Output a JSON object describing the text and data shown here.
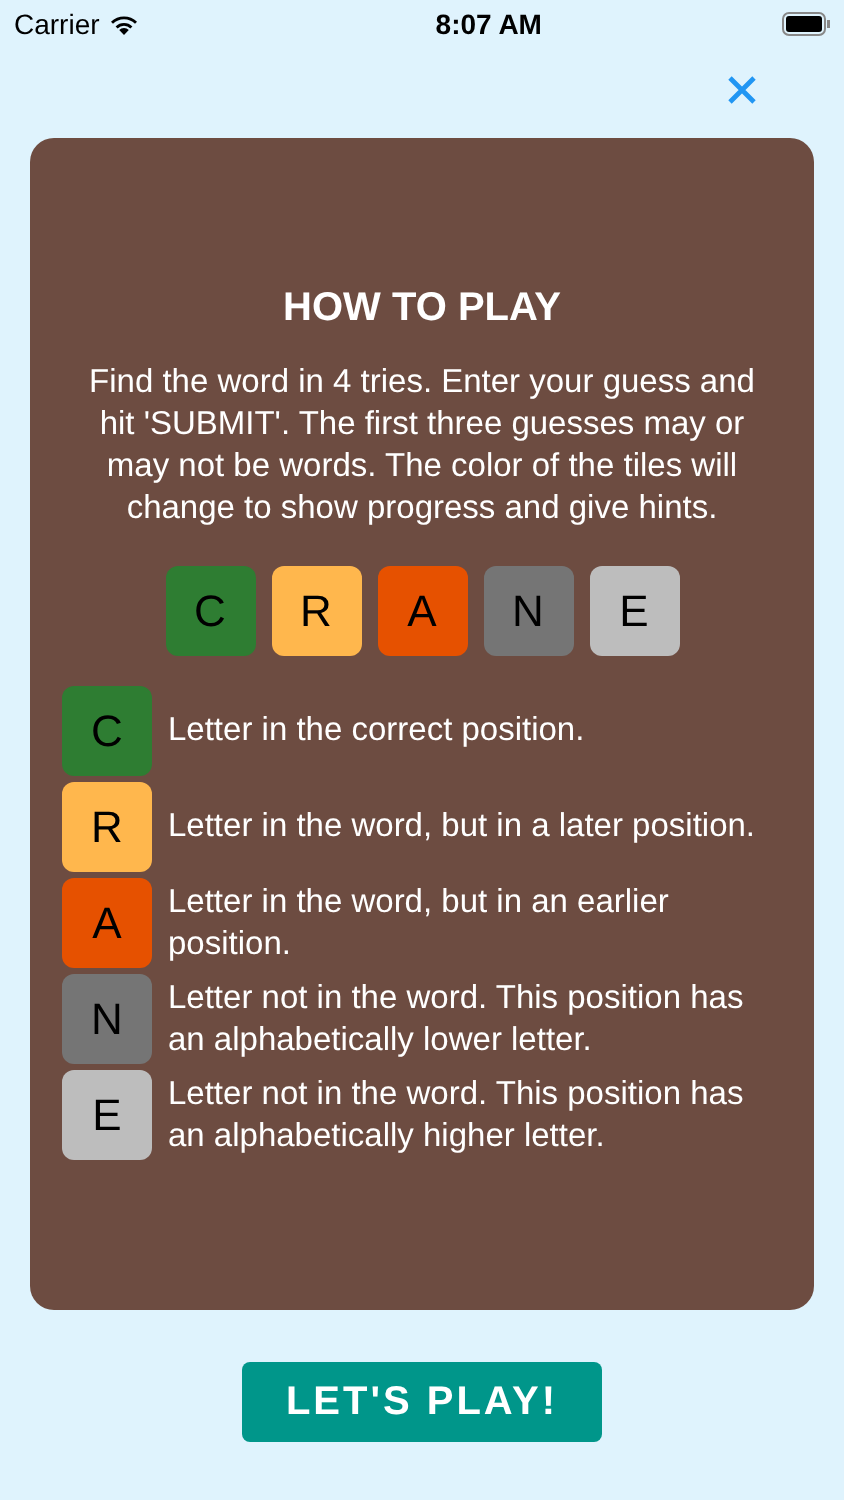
{
  "status_bar": {
    "carrier": "Carrier",
    "time": "8:07 AM"
  },
  "title": "HOW TO PLAY",
  "intro": "Find the word in 4 tries. Enter your guess and hit 'SUBMIT'. The first three guesses may or may not be words. The color of the tiles will change to show progress and give hints.",
  "example_tiles": [
    {
      "letter": "C",
      "color": "#2e7d32"
    },
    {
      "letter": "R",
      "color": "#ffb74d"
    },
    {
      "letter": "A",
      "color": "#e65100"
    },
    {
      "letter": "N",
      "color": "#757575"
    },
    {
      "letter": "E",
      "color": "#bdbdbd"
    }
  ],
  "legend": [
    {
      "letter": "C",
      "color": "#2e7d32",
      "text": "Letter in the correct position."
    },
    {
      "letter": "R",
      "color": "#ffb74d",
      "text": "Letter in the word, but in a later position."
    },
    {
      "letter": "A",
      "color": "#e65100",
      "text": "Letter in the word, but in an earlier position."
    },
    {
      "letter": "N",
      "color": "#757575",
      "text": "Letter not in the word. This position has an alphabetically lower letter."
    },
    {
      "letter": "E",
      "color": "#bdbdbd",
      "text": "Letter not in the word. This position has an alphabetically higher letter."
    }
  ],
  "play_button": "LET'S PLAY!"
}
